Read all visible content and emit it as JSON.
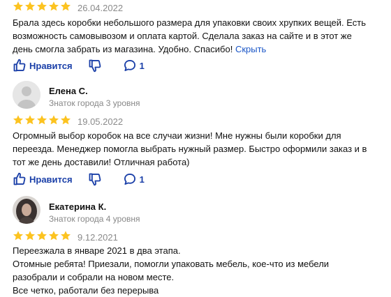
{
  "reviews": [
    {
      "rating": 5,
      "date": "26.04.2022",
      "text_lines": [
        "Брала здесь коробки небольшого размера для упаковки своих хрупких вещей. Есть",
        "возможность самовывозом и оплата картой. Сделала заказ на сайте и в этот же",
        "день смогла забрать из магазина. Удобно. Спасибо!"
      ],
      "hide_link": "Скрыть",
      "like_label": "Нравится",
      "comments_count": "1"
    },
    {
      "author": "Елена С.",
      "level": "Знаток города 3 уровня",
      "rating": 5,
      "date": "19.05.2022",
      "text_lines": [
        "Огромный выбор коробок на все случаи жизни! Мне нужны были коробки для",
        "переезда. Менеджер помогла выбрать нужный размер. Быстро оформили заказ и в",
        "тот же день доставили! Отличная работа)"
      ],
      "like_label": "Нравится",
      "comments_count": "1"
    },
    {
      "author": "Екатерина К.",
      "level": "Знаток города 4 уровня",
      "rating": 5,
      "date": "9.12.2021",
      "text_lines": [
        "Переезжала в январе 2021 в два этапа.",
        "Отомные ребята! Приезали, помогли упаковать мебель, кое-что из мебели",
        "разобрали и собрали на новом месте.",
        "Все четко, работали без перерыва"
      ]
    }
  ],
  "colors": {
    "star": "#fcc320",
    "accent": "#1a3fa8",
    "link": "#1a56c7"
  },
  "icons": [
    "star-icon",
    "thumb-up-icon",
    "thumb-down-icon",
    "comment-icon",
    "avatar-icon"
  ]
}
